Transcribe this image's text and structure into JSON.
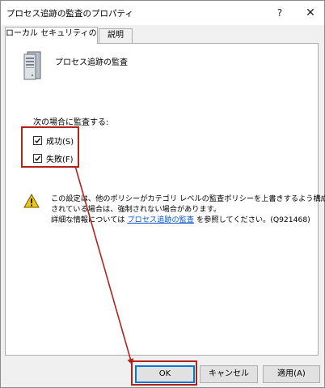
{
  "window": {
    "title": "プロセス追跡の監査のプロパティ",
    "help_glyph": "?",
    "close_glyph": "✕"
  },
  "tabs": [
    {
      "label": "ローカル セキュリティの設定",
      "active": true
    },
    {
      "label": "説明",
      "active": false
    }
  ],
  "policy": {
    "icon": "server-icon",
    "name": "プロセス追跡の監査"
  },
  "audit": {
    "label": "次の場合に監査する:",
    "options": [
      {
        "label": "成功(S)",
        "checked": true
      },
      {
        "label": "失敗(F)",
        "checked": true
      }
    ]
  },
  "warning": {
    "icon": "warning-icon",
    "line1": "この設定は、他のポリシーがカテゴリ レベルの監査ポリシーを上書きするよう構成",
    "line2": "されている場合は、強制されない場合があります。",
    "line3_prefix": "詳細な情報については ",
    "link_text": "プロセス追跡の監査",
    "line3_suffix": " を参照してください。(Q921468)"
  },
  "buttons": {
    "ok": "OK",
    "cancel": "キャンセル",
    "apply": "適用(A)"
  },
  "annotation": {
    "highlight_color": "#b0241c"
  }
}
